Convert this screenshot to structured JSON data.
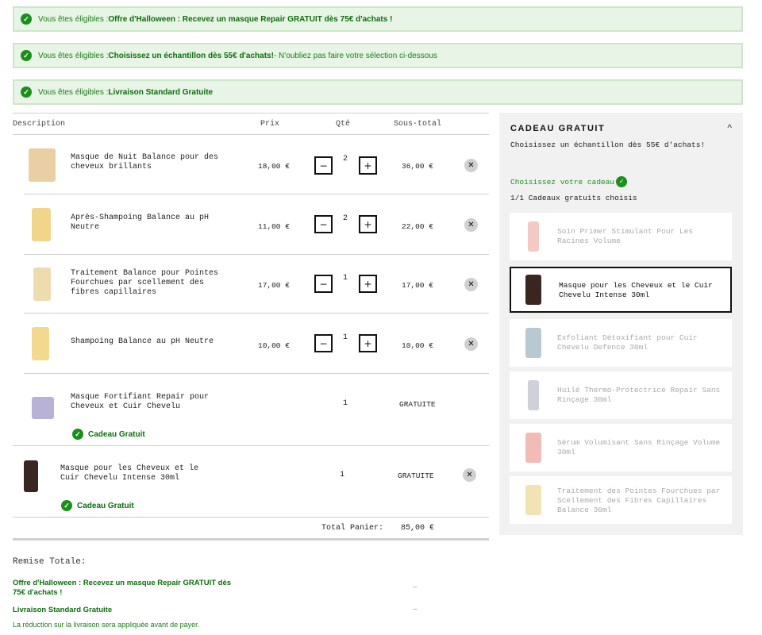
{
  "banners": [
    {
      "prefix": "Vous êtes éligibles : ",
      "bold": "Offre d'Halloween : Recevez un masque Repair GRATUIT dès 75€ d'achats !",
      "suffix": ""
    },
    {
      "prefix": "Vous êtes éligibles : ",
      "bold": "Choisissez un échantillon dès 55€ d'achats!",
      "suffix": " - N'oubliez pas faire votre sélection ci-dessous"
    },
    {
      "prefix": "Vous êtes éligibles : ",
      "bold": "Livraison Standard Gratuite",
      "suffix": ""
    }
  ],
  "table": {
    "headers": {
      "description": "Description",
      "price": "Prix",
      "qty": "Qté",
      "subtotal": "Sous-total"
    },
    "items": [
      {
        "name": "Masque de Nuit Balance pour des cheveux brillants",
        "price": "18,00 €",
        "qty": "2",
        "subtotal": "36,00 €",
        "thumb_color": "#e9cfa3"
      },
      {
        "name": "Après-Shampoing Balance au pH Neutre",
        "price": "11,00 €",
        "qty": "2",
        "subtotal": "22,00 €",
        "thumb_color": "#f0d58a"
      },
      {
        "name": "Traitement Balance pour Pointes Fourchues par scellement des fibres capillaires",
        "price": "17,00 €",
        "qty": "1",
        "subtotal": "17,00 €",
        "thumb_color": "#efdcae"
      },
      {
        "name": "Shampoing Balance au pH Neutre",
        "price": "10,00 €",
        "qty": "1",
        "subtotal": "10,00 €",
        "thumb_color": "#f2d98f"
      },
      {
        "name": "Masque Fortifiant Repair pour Cheveux et Cuir Chevelu",
        "qty": "1",
        "subtotal": "GRATUITE",
        "gift_label": "Cadeau Gratuit",
        "thumb_color": "#b7b2d6"
      },
      {
        "name": "Masque pour les Cheveux et le Cuir Chevelu Intense 30ml",
        "qty": "1",
        "subtotal": "GRATUITE",
        "gift_label": "Cadeau Gratuit",
        "thumb_color": "#3b2521"
      }
    ],
    "minus_label": "−",
    "plus_label": "+",
    "remove_label": "✕",
    "total_label": "Total Panier:",
    "total_value": "85,00 €"
  },
  "sidebar": {
    "title": "CADEAU GRATUIT",
    "chevron": "^",
    "subtitle": "Choisissez un échantillon dès 55€ d'achats!",
    "choose_label": "Choisissez votre cadeau",
    "count_label": "1/1 Cadeaux gratuits choisis",
    "gifts": [
      {
        "name": "Soin Primer Stimulant Pour Les Racines Volume",
        "selected": false,
        "color": "#f3c9c4"
      },
      {
        "name": "Masque pour les Cheveux et le Cuir Chevelu Intense 30ml",
        "selected": true,
        "color": "#3b2521"
      },
      {
        "name": "Exfoliant Détoxifiant pour Cuir Chevelu Defence 30ml",
        "selected": false,
        "color": "#b9c9d1"
      },
      {
        "name": "Huilé Thermo-Protectrice Repair Sans Rinçage 30ml",
        "selected": false,
        "color": "#cfd0da"
      },
      {
        "name": "Sérum Volumisant Sans Rinçage Volume 30ml",
        "selected": false,
        "color": "#f2bcb6"
      },
      {
        "name": "Traitement des Pointes Fourchues par Scellement des Fibres Capillaires Balance 30ml",
        "selected": false,
        "color": "#f2e3b4"
      }
    ]
  },
  "discounts": {
    "title": "Remise Totale:",
    "items": [
      {
        "label": "Offre d'Halloween : Recevez un masque Repair GRATUIT dès 75€ d'achats !",
        "value": "–"
      },
      {
        "label": "Livraison Standard Gratuite",
        "value": "–"
      }
    ],
    "note": "La réduction sur la livraison sera appliquée avant de payer."
  },
  "colors": {
    "accent_green": "#1a8f1a",
    "banner_bg": "#e8f4e6",
    "sidebar_bg": "#f1f1f1"
  }
}
